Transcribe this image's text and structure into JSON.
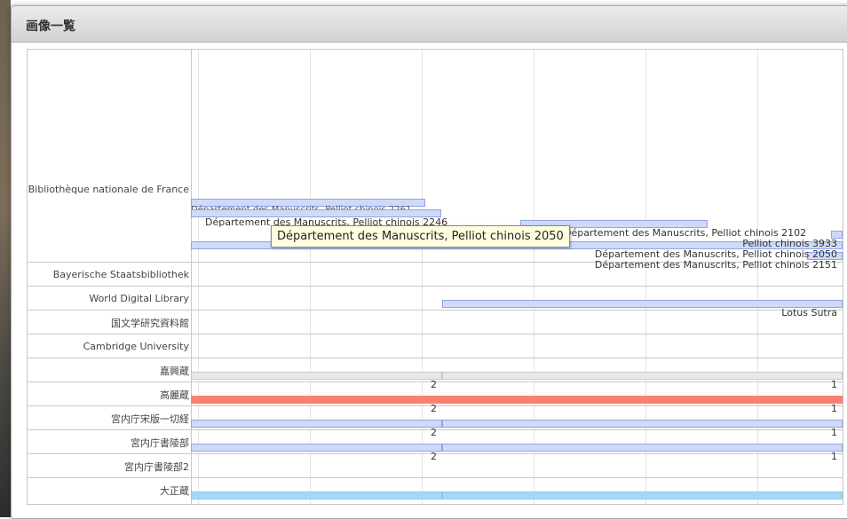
{
  "dialog": {
    "title": "画像一覧"
  },
  "rows": [
    {
      "label": "Bibliothèque nationale de France"
    },
    {
      "label": "Bayerische Staatsbibliothek"
    },
    {
      "label": "World Digital Library"
    },
    {
      "label": "国文学研究資料館"
    },
    {
      "label": "Cambridge University"
    },
    {
      "label": "嘉興蔵"
    },
    {
      "label": "高麗蔵"
    },
    {
      "label": "宮内庁宋版一切経"
    },
    {
      "label": "宮内庁書陵部"
    },
    {
      "label": "宮内庁書陵部2"
    },
    {
      "label": "大正蔵"
    }
  ],
  "bnf_labels": {
    "l1": "Département des Manuscrits, Pelliot chinois 2261",
    "l2": "Département des Manuscrits, Pelliot chinois 2246",
    "l3": "Département des Manuscrits, Pelliot chinois 2102",
    "l4": "Pelliot chinois 3933",
    "l5": "Département des Manuscrits, Pelliot chinois 2050",
    "l6": "Département des Manuscrits, Pelliot chinois 2151"
  },
  "wdl_label": "Lotus Sutra",
  "numbers": {
    "two": "2",
    "one": "1"
  },
  "tooltip": "Département des Manuscrits, Pelliot chinois 2050",
  "colors": {
    "bar_default": "#d0d9f7",
    "bar_red": "#fa8072",
    "bar_blue": "#a7d7f8"
  }
}
